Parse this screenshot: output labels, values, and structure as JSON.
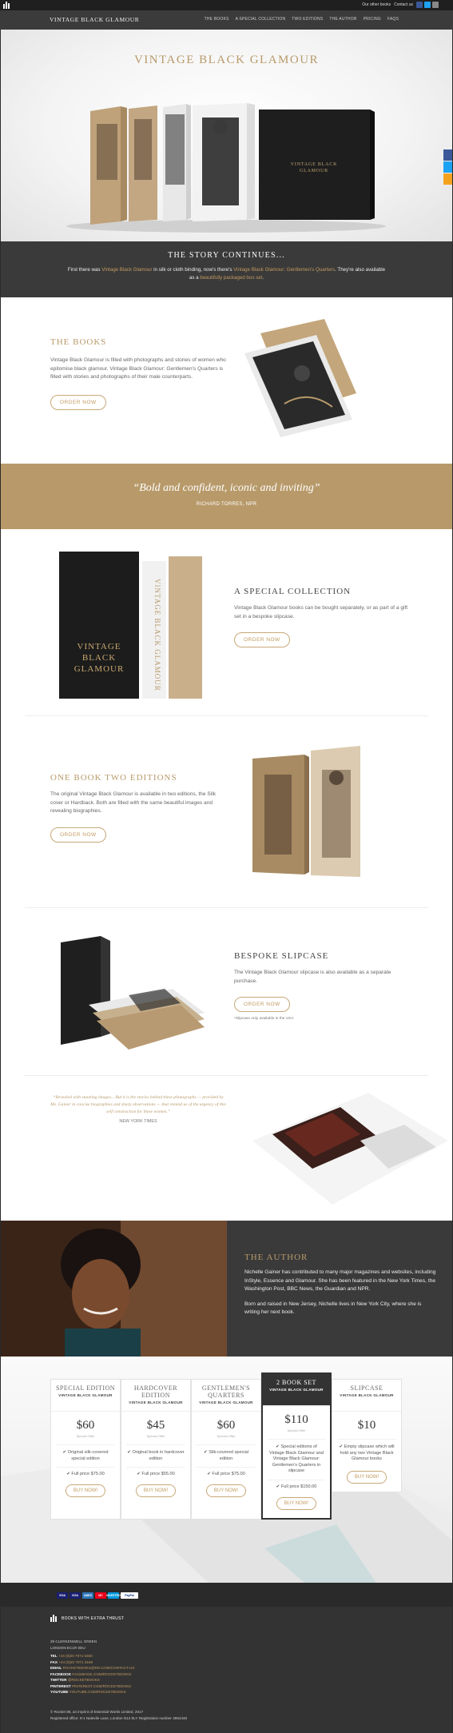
{
  "util": {
    "order_label": "Our other books",
    "contact_label": "Contact us"
  },
  "nav": {
    "brand": "VINTAGE BLACK GLAMOUR",
    "items": [
      "THE BOOKS",
      "A SPECIAL COLLECTION",
      "TWO EDITIONS",
      "THE AUTHOR",
      "PRICING",
      "FAQS"
    ]
  },
  "hero": {
    "title": "VINTAGE BLACK GLAMOUR",
    "box_title_line1": "VINTAGE BLACK",
    "box_title_line2": "GLAMOUR"
  },
  "story": {
    "heading": "THE STORY CONTINUES...",
    "text_a": "First there was ",
    "link_a": "Vintage Black Glamour",
    "text_b": " in silk or cloth binding, now's there's ",
    "link_b": "Vintage Black Glamour: Gentlemen's Quarters",
    "text_c": ". They're also available as a ",
    "link_c": "beautifully packaged box set",
    "text_d": "."
  },
  "books": {
    "heading": "THE BOOKS",
    "body": "Vintage Black Glamour is filled with photographs and stories of women who epitomise black glamour. Vintage Black Glamour: Gentlemen's Quarters is filled with stories and photographs of their male counterparts.",
    "button": "ORDER NOW"
  },
  "quote": {
    "text": "“Bold and confident, iconic and inviting”",
    "by": "RICHARD TORRES, NPR"
  },
  "collection": {
    "heading": "A SPECIAL COLLECTION",
    "body": "Vintage Black Glamour books can be bought separately, or as part of a gift set in a bespoke slipcase.",
    "button": "ORDER NOW",
    "box_line1": "VINTAGE",
    "box_line2": "BLACK",
    "box_line3": "GLAMOUR",
    "spine_text": "VINTAGE BLACK GLAMOUR"
  },
  "editions": {
    "heading": "ONE BOOK TWO EDITIONS",
    "body": "The original Vintage Black Glamour is available in two editions, the Silk cover or Hardback. Both are filled with the same beautiful images and revealing biographies.",
    "button": "ORDER NOW"
  },
  "slipcase": {
    "heading": "BESPOKE SLIPCASE",
    "body": "The Vintage Black Glamour slipcase is also available as a separate purchase.",
    "button": "ORDER NOW",
    "footnote": "*Slipcase only available in the USA"
  },
  "review": {
    "text": "“Revealed with stunning images... But it is the stories behind these photographs — provided by Ms. Gainer in concise biographies and sharp observations — that remind us of the urgency of this self construction for these women.”",
    "by": "NEW YORK TIMES"
  },
  "author": {
    "heading": "THE AUTHOR",
    "para1": "Nichelle Gainer has contributed to many major magazines and websites, including InStyle, Essence and Glamour. She has been featured in the New York Times, the Washington Post, BBC News, the Guardian and NPR.",
    "para2": "Born and raised in New Jersey, Nichelle lives in New York City, where she is writing her next book."
  },
  "pricing": {
    "plans": [
      {
        "name": "SPECIAL EDITION",
        "sub": "VINTAGE BLACK GLAMOUR",
        "price": "$60",
        "note": "Special Offer",
        "feature": "✔ Original silk-covered special edition",
        "full": "✔ Full price $75.00",
        "button": "BUY NOW!"
      },
      {
        "name": "HARDCOVER EDITION",
        "sub": "VINTAGE BLACK GLAMOUR",
        "price": "$45",
        "note": "Special Offer",
        "feature": "✔ Original book in hardcover edition",
        "full": "✔ Full price $55.00",
        "button": "BUY NOW!"
      },
      {
        "name": "GENTLEMEN'S QUARTERS",
        "sub": "VINTAGE BLACK GLAMOUR",
        "price": "$60",
        "note": "Special Offer",
        "feature": "✔ Silk-covered special edition",
        "full": "✔ Full price $75.00",
        "button": "BUY NOW!"
      },
      {
        "name": "2 BOOK SET",
        "sub": "VINTAGE BLACK GLAMOUR",
        "price": "$110",
        "note": "Special Offer",
        "feature": "✔ Special editions of Vintage Black Glamour and Vintage Black Glamour: Gentlemen's Quarters in slipcase",
        "full": "✔ Full price $150.00",
        "button": "BUY NOW!"
      },
      {
        "name": "SLIPCASE",
        "sub": "VINTAGE BLACK GLAMOUR",
        "price": "$10",
        "note": "",
        "feature": "✔ Empty slipcase which will hold any two Vintage Black Glamour books",
        "full": "",
        "button": "BUY NOW!"
      }
    ]
  },
  "footer": {
    "cards": [
      "VISA",
      "VISA",
      "AMEX",
      "MC",
      "MAESTRO",
      "PayPal"
    ],
    "brand": "BOOKS WITH EXTRA THRUST",
    "address_lines": [
      "29 CLERKENWELL GREEN",
      "LONDON EC1R 0DU"
    ],
    "contacts": [
      {
        "label": "TEL",
        "value": "+44 (0)20 7071 0450"
      },
      {
        "label": "FAX",
        "value": "+44 (0)20 7071 3169"
      },
      {
        "label": "EMAIL",
        "value": "ROCKETBOOKS@RO.COM/CONTACT-US"
      },
      {
        "label": "FACEBOOK",
        "value": "FACEBOOK.COM/ROCKETBOOKS"
      },
      {
        "label": "TWITTER",
        "value": "@ROCKETBOOKS"
      },
      {
        "label": "PINTEREST",
        "value": "PINTEREST.COM/ROCKETBOOKS"
      },
      {
        "label": "YOUTUBE",
        "value": "YOUTUBE.COM/ROCKETBOOKS"
      }
    ],
    "legal1": "© Rocket 88, an imprint of Essential Works Limited, 2017",
    "legal2": "Registered office: 9-1 Nalevile Lane, London N12 8LY  Registration number 4964446"
  },
  "colors": {
    "gold": "#b89a6a",
    "dark": "#3a3a3a",
    "facebook": "#3b5998",
    "twitter": "#1da1f2",
    "email": "#f4a21e"
  }
}
